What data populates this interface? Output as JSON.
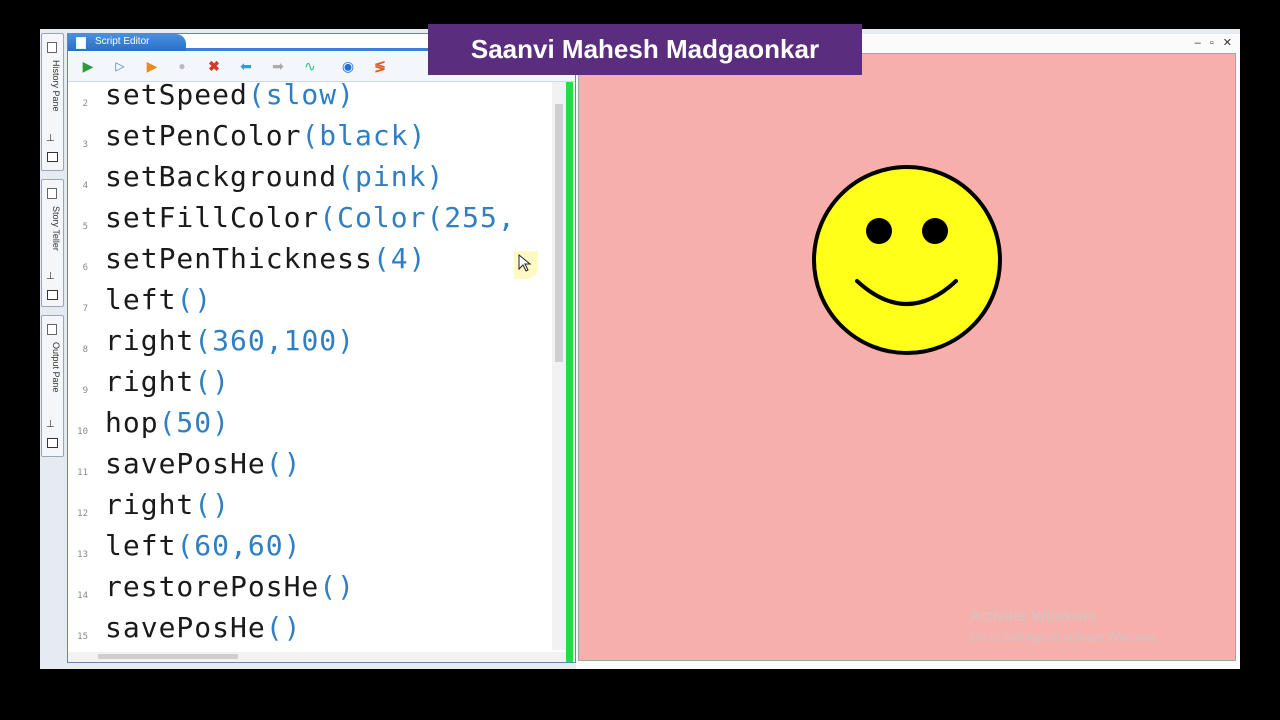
{
  "banner": {
    "name": "Saanvi Mahesh Madgaonkar"
  },
  "side_panes": [
    {
      "label": "History Pane"
    },
    {
      "label": "Story Teller"
    },
    {
      "label": "Output Pane"
    }
  ],
  "editor": {
    "tab_title": "Script Editor",
    "toolbar_icons": [
      "run-icon",
      "step-icon",
      "run-step-icon",
      "stop-icon",
      "clear-icon",
      "undo-icon",
      "redo-icon",
      "format-icon",
      "globe-icon",
      "debug-icon"
    ],
    "lines": [
      {
        "num": "2",
        "fn": "setSpeed",
        "args": "(slow)"
      },
      {
        "num": "3",
        "fn": "setPenColor",
        "args": "(black)"
      },
      {
        "num": "4",
        "fn": "setBackground",
        "args": "(pink)"
      },
      {
        "num": "5",
        "fn": "setFillColor",
        "args": "(Color(255,"
      },
      {
        "num": "6",
        "fn": "setPenThickness",
        "args": "(4)"
      },
      {
        "num": "7",
        "fn": "left",
        "args": "()"
      },
      {
        "num": "8",
        "fn": "right",
        "args": "(360,100)"
      },
      {
        "num": "9",
        "fn": "right",
        "args": "()"
      },
      {
        "num": "10",
        "fn": "hop",
        "args": "(50)"
      },
      {
        "num": "11",
        "fn": "savePosHe",
        "args": "()"
      },
      {
        "num": "12",
        "fn": "right",
        "args": "()"
      },
      {
        "num": "13",
        "fn": "left",
        "args": "(60,60)"
      },
      {
        "num": "14",
        "fn": "restorePosHe",
        "args": "()"
      },
      {
        "num": "15",
        "fn": "savePosHe",
        "args": "()"
      }
    ]
  },
  "canvas": {
    "background": "#f7afac",
    "face_color": "#ffff1a",
    "stroke_color": "#000000"
  },
  "watermark": {
    "line1": "Activate Windows",
    "line2": "Go to Settings to activate Windows."
  },
  "window_controls": [
    "–",
    "▫",
    "✕"
  ]
}
